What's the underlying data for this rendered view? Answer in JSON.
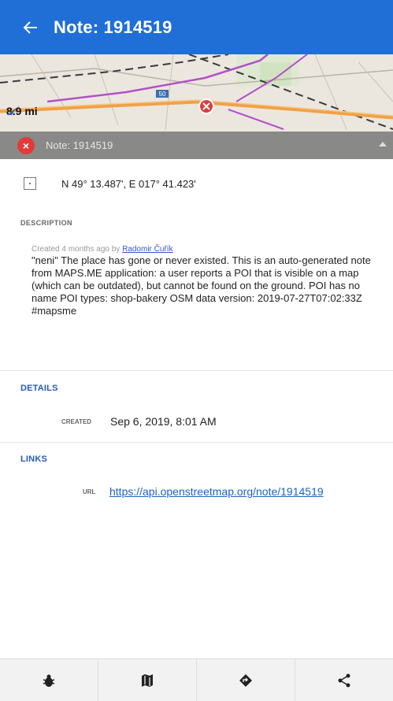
{
  "appbar": {
    "title": "Note: 1914519",
    "back_icon": "arrow-left-icon"
  },
  "map": {
    "distance": "8.9 mi",
    "road_label": "50",
    "strip_title": "Note: 1914519"
  },
  "location": {
    "coordinates": "N 49° 13.487', E 017° 41.423'"
  },
  "description": {
    "label": "DESCRIPTION",
    "created_prefix": "Created 4 months ago by ",
    "author": "Radomir Čuřík",
    "text": "\"neni\" The place has gone or never existed. This is an auto-generated note from MAPS.ME application: a user reports a POI that is visible on a map (which can be outdated), but cannot be found on the ground. POI has no name POI types: shop-bakery OSM data version: 2019-07-27T07:02:33Z #mapsme"
  },
  "details": {
    "label": "DETAILS",
    "created_key": "CREATED",
    "created_value": "Sep 6, 2019, 8:01 AM"
  },
  "links": {
    "label": "LINKS",
    "url_key": "URL",
    "url_value": "https://api.openstreetmap.org/note/1914519"
  },
  "bottom_bar": {
    "buttons": [
      {
        "icon": "bug-icon"
      },
      {
        "icon": "map-icon"
      },
      {
        "icon": "navigate-icon"
      },
      {
        "icon": "share-icon"
      }
    ]
  },
  "colors": {
    "appbar": "#1f6fd6",
    "link": "#1b63c2",
    "section_blue": "#2659b8",
    "note_badge": "#e23a3a"
  }
}
